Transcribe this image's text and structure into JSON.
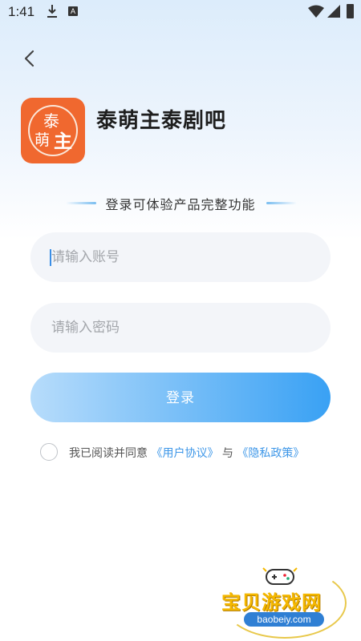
{
  "status_bar": {
    "time": "1:41",
    "download_icon": "download-icon",
    "notification_letter": "A",
    "icons": [
      "wifi-icon",
      "signal-icon",
      "battery-icon"
    ]
  },
  "header": {
    "back_icon": "back-arrow-icon"
  },
  "app": {
    "logo_line1": "泰",
    "logo_line2a": "萌",
    "logo_line2b": "主",
    "name": "泰萌主泰剧吧",
    "logo_color": "#f0682f"
  },
  "tagline": "登录可体验产品完整功能",
  "form": {
    "account_placeholder": "请输入账号",
    "account_value": "",
    "password_placeholder": "请输入密码",
    "password_value": "",
    "login_label": "登录",
    "accent_color": "#39a1f4"
  },
  "agreement": {
    "prefix": "我已阅读并同意",
    "user_agreement": "《用户协议》",
    "conjunction": "与",
    "privacy_policy": "《隐私政策》",
    "checked": false
  },
  "watermark": {
    "text": "宝贝游戏网",
    "url": "baobeiy.com"
  }
}
